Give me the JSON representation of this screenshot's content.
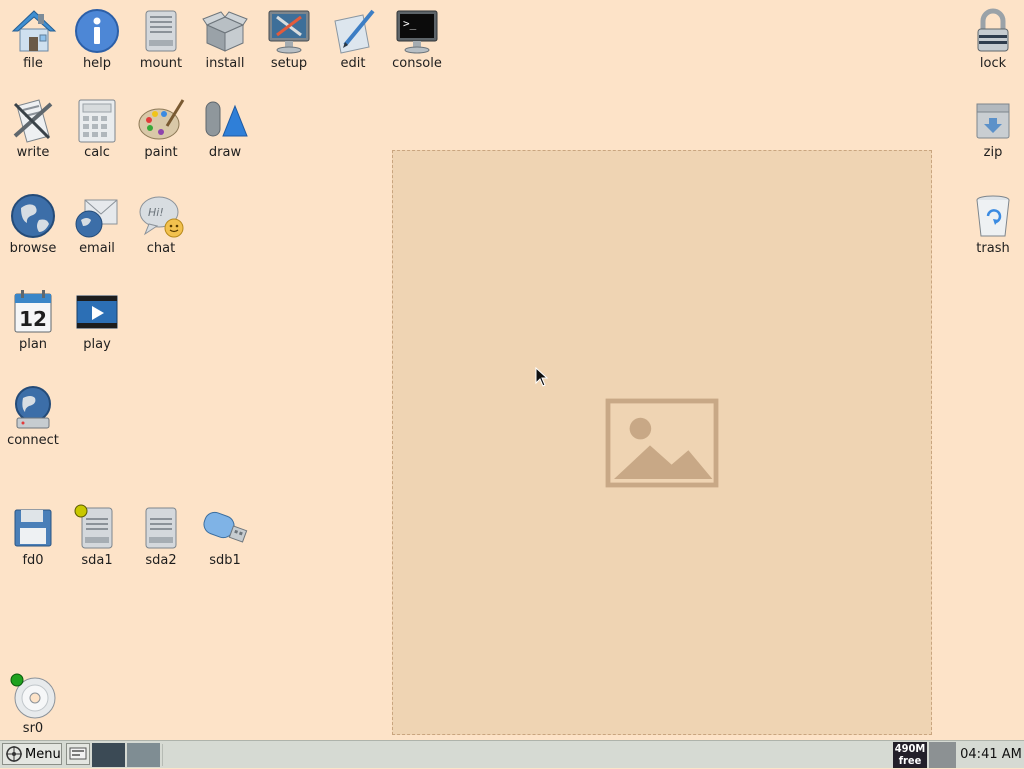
{
  "desktop": {
    "wallpaper_note": "puppy photograph wallpaper (placeholder)",
    "icons": {
      "file": "file",
      "help": "help",
      "mount": "mount",
      "install": "install",
      "setup": "setup",
      "edit": "edit",
      "console": "console",
      "lock": "lock",
      "write": "write",
      "calc": "calc",
      "paint": "paint",
      "draw": "draw",
      "zip": "zip",
      "browse": "browse",
      "email": "email",
      "chat": "chat",
      "trash": "trash",
      "plan": "plan",
      "play": "play",
      "connect": "connect",
      "fd0": "fd0",
      "sda1": "sda1",
      "sda2": "sda2",
      "sdb1": "sdb1",
      "sr0": "sr0"
    },
    "plan_day": "12",
    "console_prompt": ">_",
    "chat_text": "Hi!"
  },
  "taskbar": {
    "menu_label": "Menu",
    "free_mem_value": "490M",
    "free_mem_label": "free",
    "clock": "04:41 AM"
  },
  "colors": {
    "desktop_bg": "#fde3c8",
    "taskbar_bg": "#d6dad3",
    "drive_mounted_led": "#c8c800",
    "drive_active_led": "#1fa21f"
  }
}
